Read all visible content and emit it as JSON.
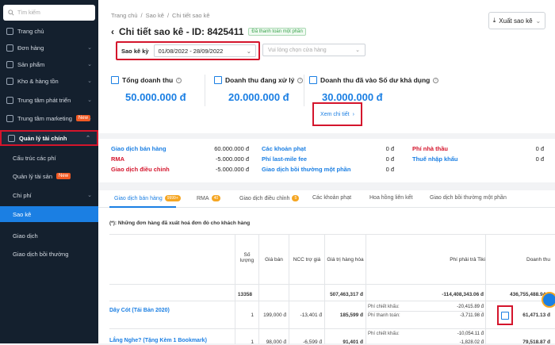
{
  "sidebar": {
    "search_placeholder": "Tìm kiếm",
    "items": [
      {
        "label": "Trang chủ"
      },
      {
        "label": "Đơn hàng"
      },
      {
        "label": "Sản phẩm"
      },
      {
        "label": "Kho & hàng tồn"
      },
      {
        "label": "Trung tâm phát triển"
      },
      {
        "label": "Trung tâm marketing",
        "badge": "New"
      },
      {
        "label": "Quản lý tài chính"
      },
      {
        "label": "Cấu trúc các phí"
      },
      {
        "label": "Quản lý tài sản",
        "badge": "New"
      },
      {
        "label": "Chi phí"
      },
      {
        "label": "Sao kê"
      },
      {
        "label": "Giao dịch"
      },
      {
        "label": "Giao dịch bồi thường"
      }
    ]
  },
  "breadcrumb": [
    "Trang chủ",
    "/",
    "Sao kê",
    "/",
    "Chi tiết sao kê"
  ],
  "title": "Chi tiết sao kê - ID: 8425411",
  "status_tag": "Đã thanh toán một phần",
  "export_label": "Xuất sao kê",
  "filter": {
    "label": "Sao kê kỳ",
    "value": "01/08/2022 - 28/09/2022"
  },
  "shop_select": {
    "placeholder": "Vui lòng chọn cửa hàng"
  },
  "stats": [
    {
      "label": "Tổng doanh thu",
      "value": "50.000.000 đ"
    },
    {
      "label": "Doanh thu đang xử lý",
      "value": "20.000.000 đ"
    },
    {
      "label": "Doanh thu đã vào Số dư khả dụng",
      "value": "30.000.000 đ"
    }
  ],
  "detail_link": "Xem chi tiết",
  "summary": {
    "col1": [
      {
        "label": "Giao dịch bán hàng",
        "value": "60.000.000 đ",
        "color": "#1b7fe3"
      },
      {
        "label": "RMA",
        "value": "-5.000.000 đ",
        "color": "#d4152c"
      },
      {
        "label": "Giao dịch điều chỉnh",
        "value": "-5.000.000 đ",
        "color": "#d4152c"
      }
    ],
    "col2": [
      {
        "label": "Các khoản phạt",
        "value": "0 đ",
        "color": "#1b7fe3"
      },
      {
        "label": "Phí last-mile fee",
        "value": "0 đ",
        "color": "#1b7fe3"
      },
      {
        "label": "Giao dịch bồi thường một phần",
        "value": "0 đ",
        "color": "#1b7fe3"
      }
    ],
    "col3": [
      {
        "label": "Phí nhà thầu",
        "value": "0 đ",
        "color": "#d4152c"
      },
      {
        "label": "Thuế nhập khẩu",
        "value": "0 đ",
        "color": "#1b7fe3"
      }
    ]
  },
  "tabs": [
    {
      "label": "Giao dịch bán hàng",
      "badge": "9999+"
    },
    {
      "label": "RMA",
      "badge": "40"
    },
    {
      "label": "Giao dịch điều chỉnh",
      "badge": "5"
    },
    {
      "label": "Các khoản phạt"
    },
    {
      "label": "Hoa hồng liên kết"
    },
    {
      "label": "Giao dịch bồi thường một phần"
    }
  ],
  "note": "(*): Những đơn hàng đã xuất hoá đơn đỏ cho khách hàng",
  "table": {
    "headers": [
      "Số lượng",
      "Giá bán",
      "NCC trợ giá",
      "Giá trị hàng hóa",
      "Phí phải trả Tiki",
      "Doanh thu"
    ],
    "totals": {
      "qty": "13358",
      "value": "507,463,317 đ",
      "fee": "-114,408,343.06 đ",
      "revenue": "436,755,488.94 đ"
    },
    "rows": [
      {
        "product": "Dây Cót (Tái Bản 2020)",
        "qty": "1",
        "price": "199,000 đ",
        "subsidy": "-13,401 đ",
        "value": "185,599 đ",
        "fees": [
          {
            "label": "Phí chiết khấu:",
            "value": "-20,415.89 đ"
          },
          {
            "label": "Phí thanh toán:",
            "value": "-3,711.98 đ"
          }
        ],
        "revenue": "61,471.13 đ"
      },
      {
        "product": "Lắng Nghe? (Tặng Kèm 1 Bookmark)",
        "qty": "1",
        "price": "98,000 đ",
        "subsidy": "-6,599 đ",
        "value": "91,401 đ",
        "fees": [
          {
            "label": "Phí chiết khấu:",
            "value": "-10,054.11 đ"
          },
          {
            "label": "",
            "value": "-1,828.02 đ"
          }
        ],
        "revenue": "79,518.87 đ"
      }
    ]
  }
}
